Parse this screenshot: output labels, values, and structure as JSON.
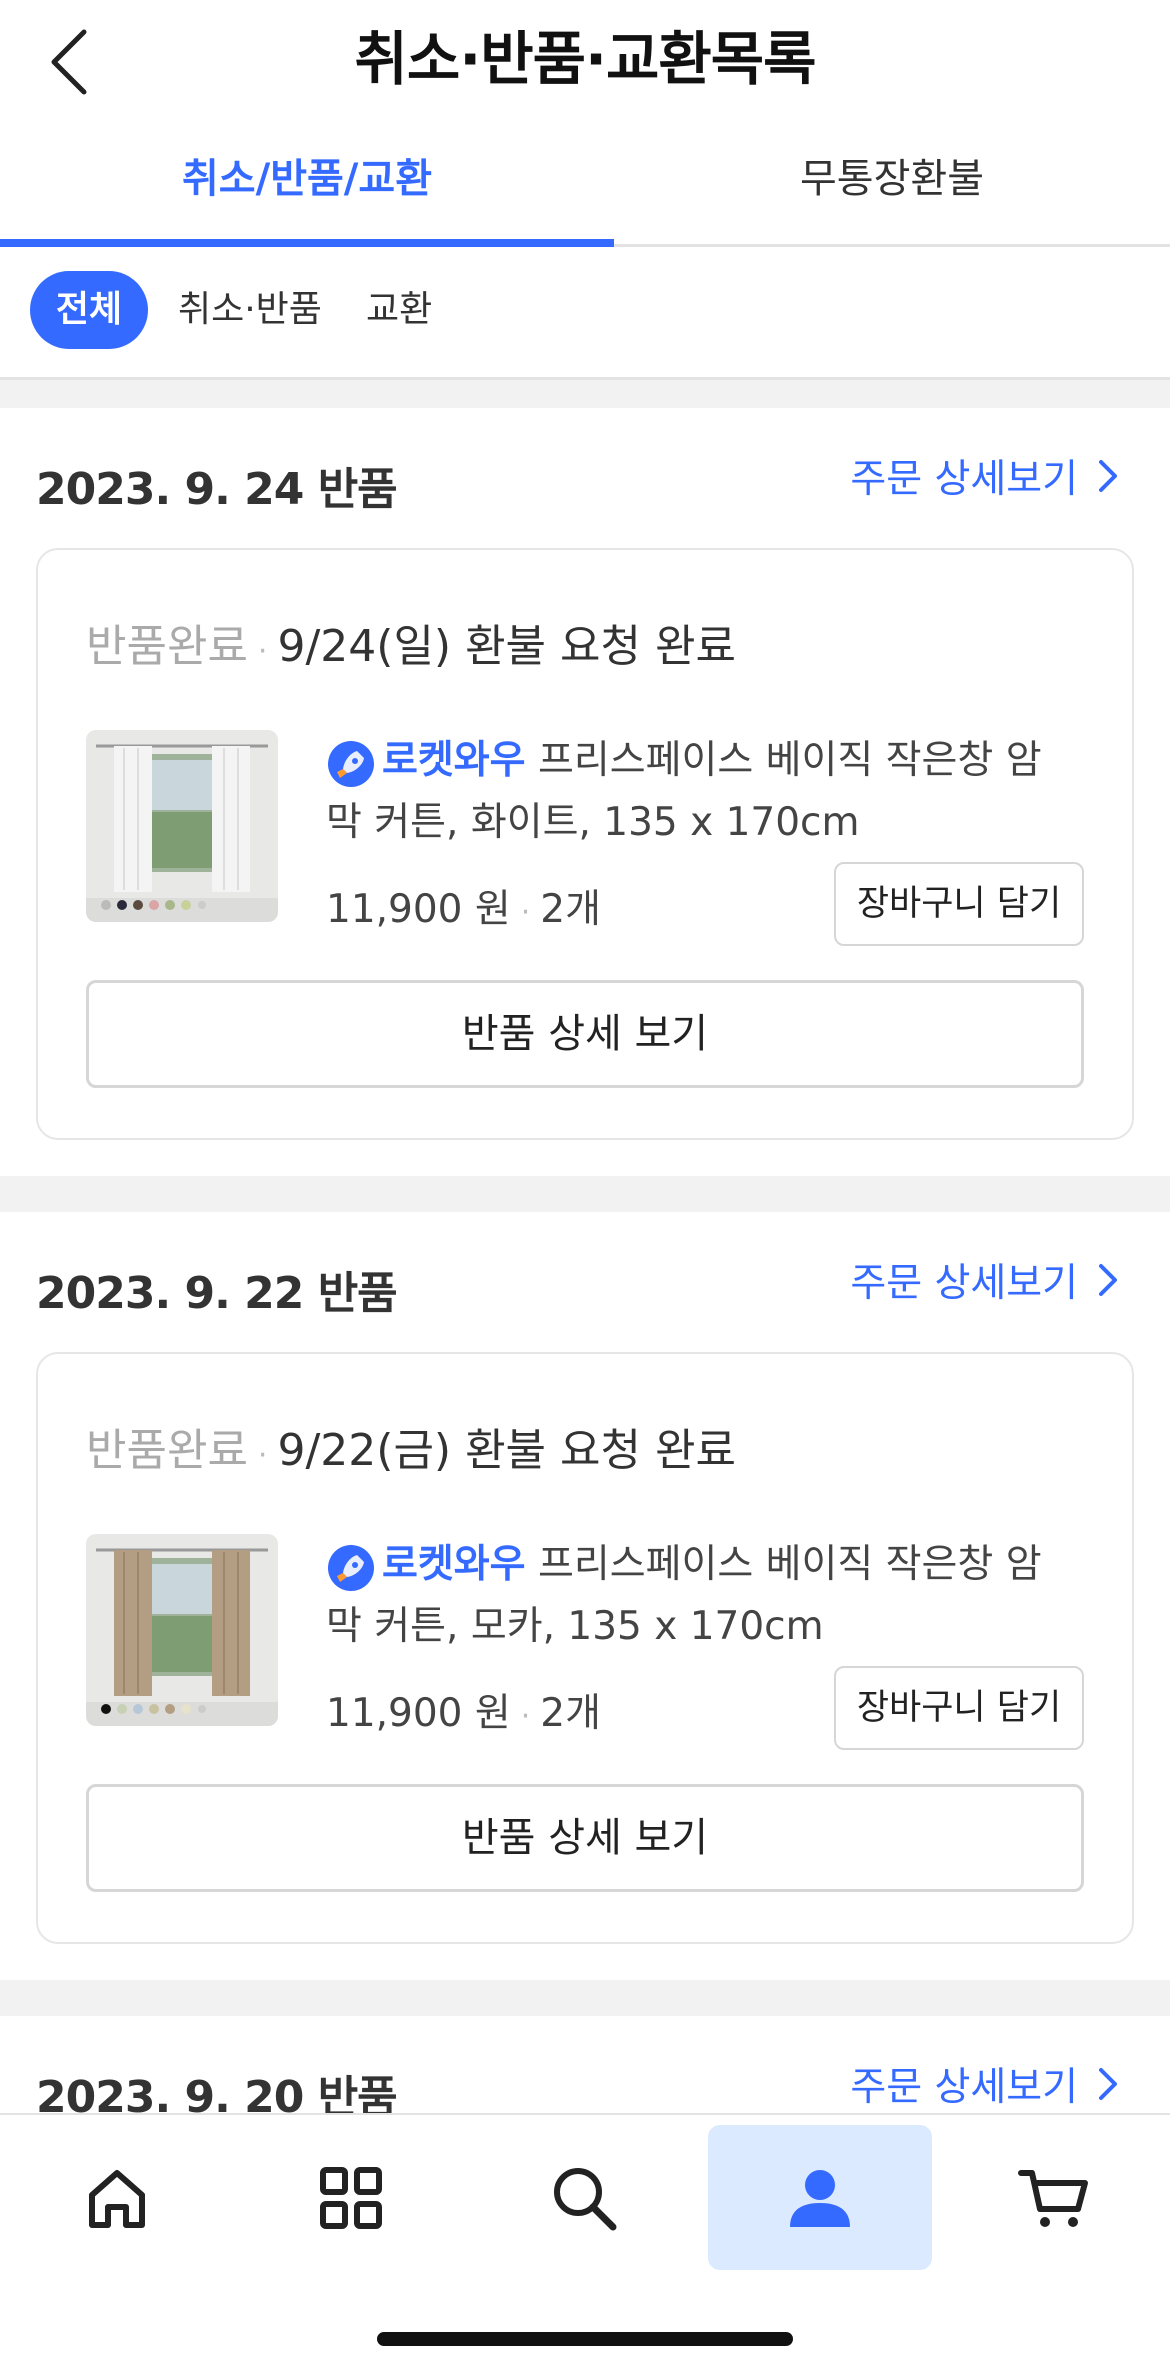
{
  "header": {
    "title": "취소·반품·교환목록"
  },
  "tabs": [
    {
      "label": "취소/반품/교환"
    },
    {
      "label": "무통장환불"
    }
  ],
  "filters": [
    {
      "label": "전체"
    },
    {
      "label": "취소·반품"
    },
    {
      "label": "교환"
    }
  ],
  "groups": [
    {
      "date": "2023. 9. 24 반품",
      "detail_link": "주문 상세보기",
      "status": "반품완료",
      "status_detail": "9/24(일) 환불 요청 완료",
      "badge": "로켓와우",
      "product_name": "프리스페이스 베이직 작은창 암막 커튼, 화이트, 135 x 170cm",
      "price": "11,900 원",
      "quantity": "2개",
      "cart_button": "장바구니 담기",
      "return_button": "반품 상세 보기",
      "curtain_color": "#f4f4f4"
    },
    {
      "date": "2023. 9. 22 반품",
      "detail_link": "주문 상세보기",
      "status": "반품완료",
      "status_detail": "9/22(금) 환불 요청 완료",
      "badge": "로켓와우",
      "product_name": "프리스페이스 베이직 작은창 암막 커튼, 모카, 135 x 170cm",
      "price": "11,900 원",
      "quantity": "2개",
      "cart_button": "장바구니 담기",
      "return_button": "반품 상세 보기",
      "curtain_color": "#b39e84"
    },
    {
      "date": "2023. 9. 20 반품",
      "detail_link": "주문 상세보기"
    }
  ],
  "bottom_nav": [
    {
      "icon": "home-icon"
    },
    {
      "icon": "category-grid-icon"
    },
    {
      "icon": "search-icon"
    },
    {
      "icon": "user-icon",
      "active": true
    },
    {
      "icon": "cart-icon"
    }
  ],
  "colors": {
    "accent": "#346aff",
    "nav_active_bg": "#dbeafe"
  }
}
